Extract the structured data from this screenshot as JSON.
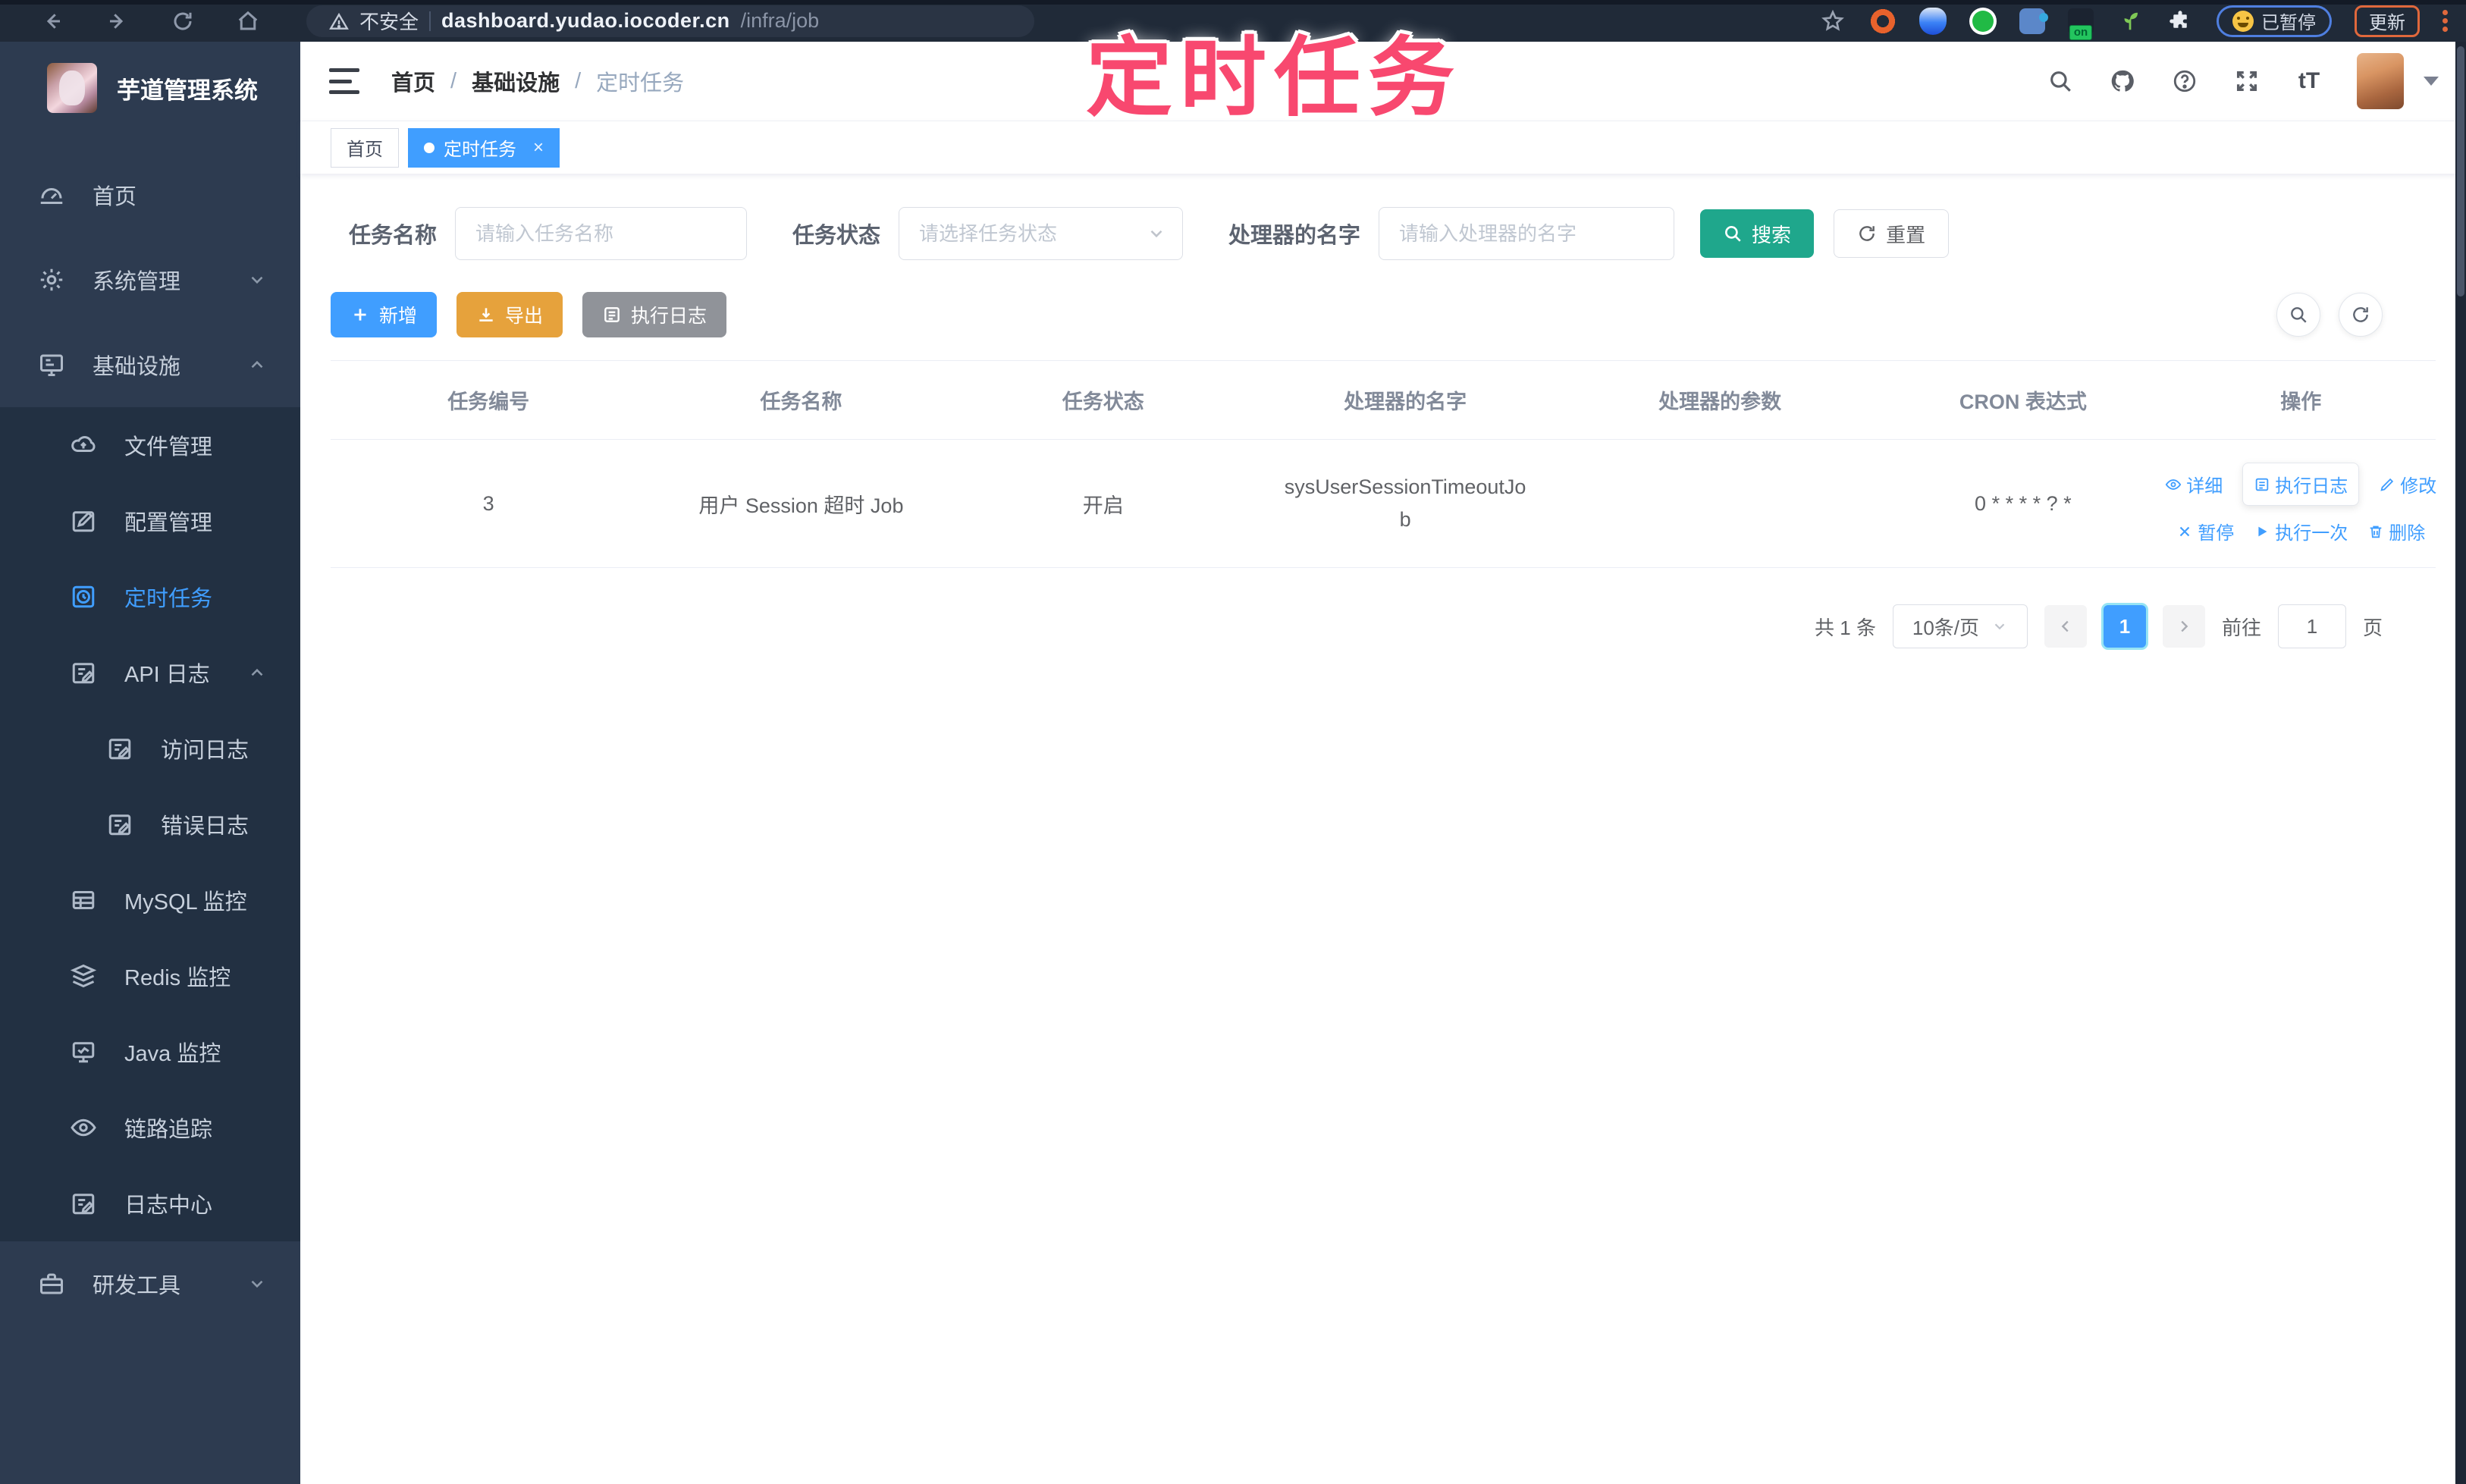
{
  "colors": {
    "accent": "#409eff",
    "search_button": "#1fa78c",
    "export_button": "#e6a23c",
    "log_button": "#909399",
    "annotation": "#f8486f",
    "sidebar_bg": "#2d3b50",
    "submenu_bg": "#223042"
  },
  "browser": {
    "security_label": "不安全",
    "url_domain": "dashboard.yudao.iocoder.cn",
    "url_path": "/infra/job",
    "extension_on_badge": "on",
    "paused_label": "已暂停",
    "update_label": "更新"
  },
  "annotation": {
    "text": "定时任务"
  },
  "sidebar": {
    "title": "芋道管理系统",
    "items": [
      {
        "label": "首页"
      },
      {
        "label": "系统管理"
      },
      {
        "label": "基础设施"
      },
      {
        "label": "文件管理"
      },
      {
        "label": "配置管理"
      },
      {
        "label": "定时任务"
      },
      {
        "label": "API 日志"
      },
      {
        "label": "访问日志"
      },
      {
        "label": "错误日志"
      },
      {
        "label": "MySQL 监控"
      },
      {
        "label": "Redis 监控"
      },
      {
        "label": "Java 监控"
      },
      {
        "label": "链路追踪"
      },
      {
        "label": "日志中心"
      },
      {
        "label": "研发工具"
      }
    ]
  },
  "header": {
    "breadcrumb": {
      "home": "首页",
      "section": "基础设施",
      "current": "定时任务"
    }
  },
  "tags": {
    "home": "首页",
    "current": "定时任务"
  },
  "filters": {
    "name_label": "任务名称",
    "name_placeholder": "请输入任务名称",
    "status_label": "任务状态",
    "status_placeholder": "请选择任务状态",
    "handler_label": "处理器的名字",
    "handler_placeholder": "请输入处理器的名字",
    "search_label": "搜索",
    "reset_label": "重置"
  },
  "toolbar": {
    "add_label": "新增",
    "export_label": "导出",
    "exec_log_label": "执行日志"
  },
  "table": {
    "headers": [
      "任务编号",
      "任务名称",
      "任务状态",
      "处理器的名字",
      "处理器的参数",
      "CRON 表达式",
      "操作"
    ],
    "row": {
      "id": "3",
      "name": "用户 Session 超时 Job",
      "status": "开启",
      "handler": "sysUserSessionTimeoutJob",
      "params": "",
      "cron": "0 * * * * ? *"
    },
    "actions": [
      {
        "label": "详细"
      },
      {
        "label": "执行日志"
      },
      {
        "label": "修改"
      },
      {
        "label": "暂停"
      },
      {
        "label": "执行一次"
      },
      {
        "label": "删除"
      }
    ]
  },
  "pagination": {
    "total": "共 1 条",
    "page_size": "10条/页",
    "page": "1",
    "goto_label": "前往",
    "goto_value": "1",
    "unit_label": "页"
  }
}
